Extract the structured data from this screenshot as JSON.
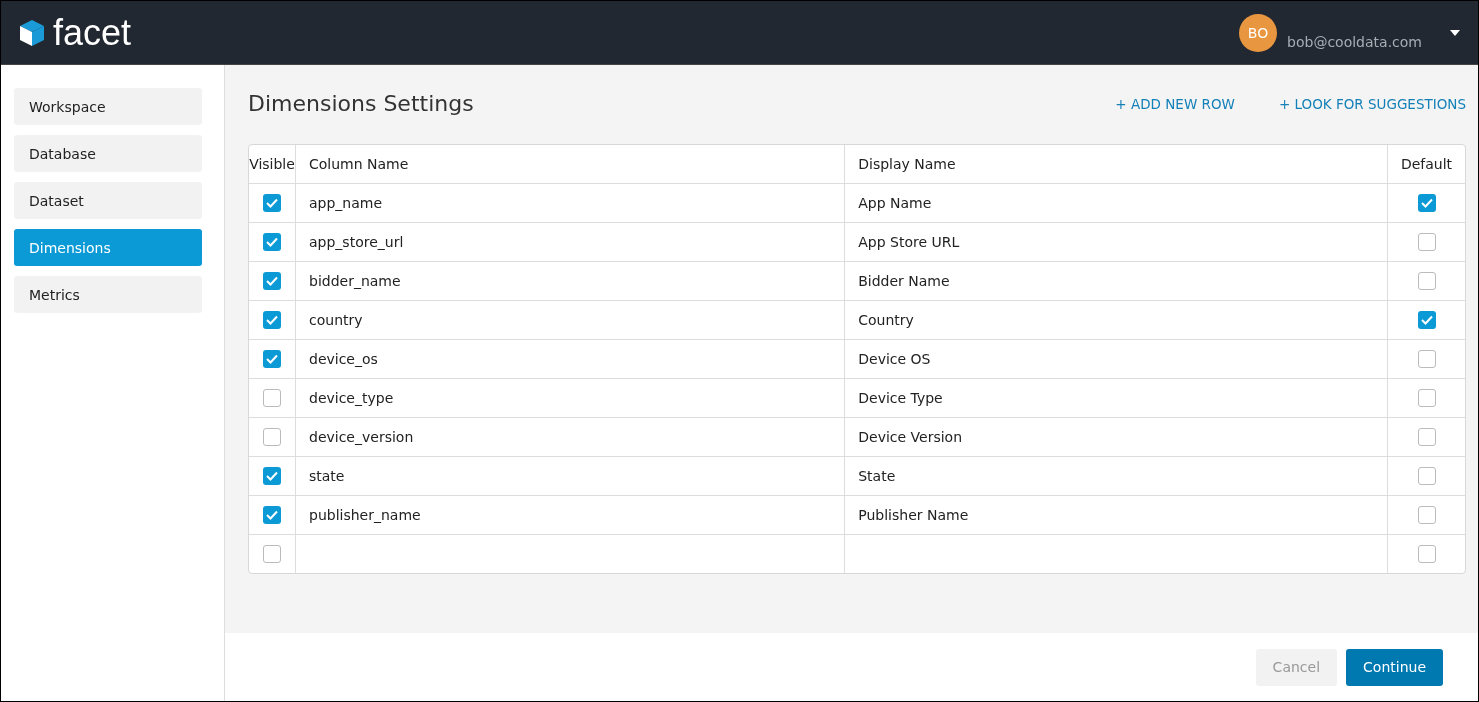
{
  "header": {
    "logo": "facet",
    "user": {
      "initials": "BO",
      "email": "bob@cooldata.com"
    }
  },
  "sidebar": {
    "items": [
      {
        "label": "Workspace",
        "selected": false
      },
      {
        "label": "Database",
        "selected": false
      },
      {
        "label": "Dataset",
        "selected": false
      },
      {
        "label": "Dimensions",
        "selected": true
      },
      {
        "label": "Metrics",
        "selected": false
      }
    ]
  },
  "page": {
    "title": "Dimensions Settings",
    "actions": [
      "+ ADD NEW ROW",
      "+ LOOK FOR SUGGESTIONS"
    ]
  },
  "table": {
    "columns": [
      "Visible",
      "Column Name",
      "Display Name",
      "Default"
    ],
    "rows": [
      {
        "visible": true,
        "column_name": "app_name",
        "display_name": "App Name",
        "default": true
      },
      {
        "visible": true,
        "column_name": "app_store_url",
        "display_name": "App Store URL",
        "default": false
      },
      {
        "visible": true,
        "column_name": "bidder_name",
        "display_name": "Bidder Name",
        "default": false
      },
      {
        "visible": true,
        "column_name": "country",
        "display_name": "Country",
        "default": true
      },
      {
        "visible": true,
        "column_name": "device_os",
        "display_name": "Device OS",
        "default": false
      },
      {
        "visible": false,
        "column_name": "device_type",
        "display_name": "Device Type",
        "default": false
      },
      {
        "visible": false,
        "column_name": "device_version",
        "display_name": "Device Version",
        "default": false
      },
      {
        "visible": true,
        "column_name": "state",
        "display_name": "State",
        "default": false
      },
      {
        "visible": true,
        "column_name": "publisher_name",
        "display_name": "Publisher Name",
        "default": false
      },
      {
        "visible": false,
        "default": false
      }
    ]
  },
  "footer": {
    "buttons": [
      {
        "label": "Cancel",
        "disabled": true
      },
      {
        "label": "Continue",
        "disabled": false
      }
    ]
  }
}
